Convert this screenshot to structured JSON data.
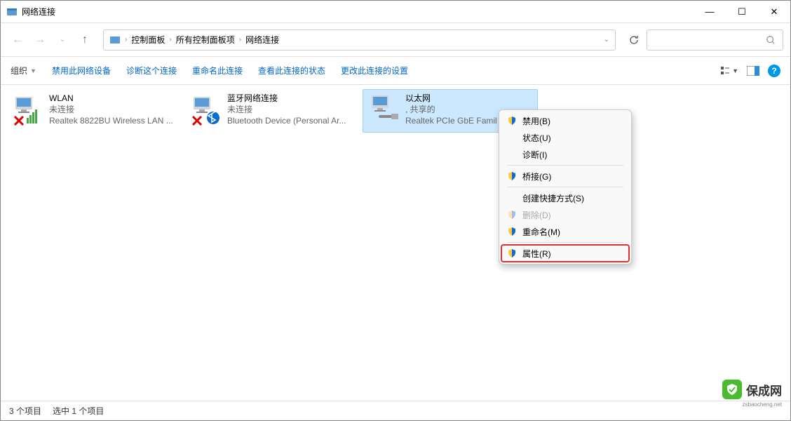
{
  "window": {
    "title": "网络连接",
    "minimize": "—",
    "maximize": "☐",
    "close": "✕"
  },
  "breadcrumb": [
    "控制面板",
    "所有控制面板项",
    "网络连接"
  ],
  "toolbar": {
    "organize": "组织",
    "disable": "禁用此网络设备",
    "diagnose": "诊断这个连接",
    "rename": "重命名此连接",
    "status": "查看此连接的状态",
    "change": "更改此连接的设置"
  },
  "connections": [
    {
      "name": "WLAN",
      "status": "未连接",
      "device": "Realtek 8822BU Wireless LAN ...",
      "type": "wifi",
      "disabled": true
    },
    {
      "name": "蓝牙网络连接",
      "status": "未连接",
      "device": "Bluetooth Device (Personal Ar...",
      "type": "bluetooth",
      "disabled": true
    },
    {
      "name": "以太网",
      "status": ", 共享的",
      "device": "Realtek PCIe GbE Famil",
      "type": "ethernet",
      "disabled": false,
      "selected": true
    }
  ],
  "contextMenu": {
    "disable": "禁用(B)",
    "status": "状态(U)",
    "diagnose": "诊断(I)",
    "bridge": "桥接(G)",
    "shortcut": "创建快捷方式(S)",
    "delete": "删除(D)",
    "rename": "重命名(M)",
    "properties": "属性(R)"
  },
  "statusbar": {
    "count": "3 个项目",
    "selected": "选中 1 个项目"
  },
  "watermark": {
    "name": "保成网",
    "sub": "zsbaocheng.net"
  }
}
